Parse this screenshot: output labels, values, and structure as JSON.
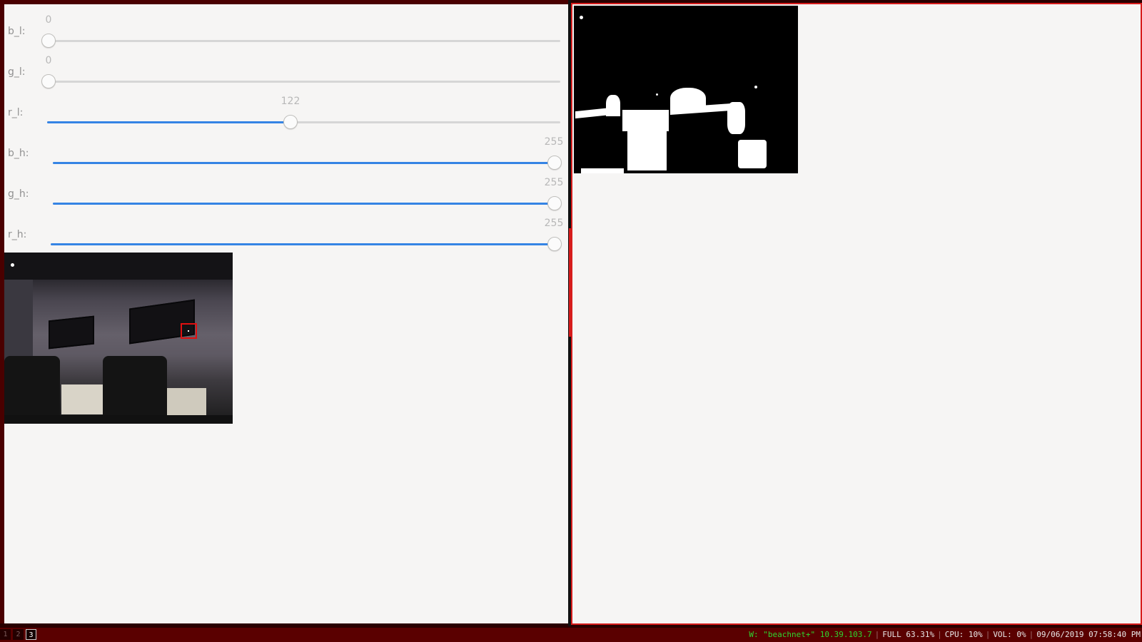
{
  "sliders": [
    {
      "key": "b_l",
      "label": "b_l:",
      "value": "0",
      "fraction": 0.0
    },
    {
      "key": "g_l",
      "label": "g_l:",
      "value": "0",
      "fraction": 0.0
    },
    {
      "key": "r_l",
      "label": "r_l:",
      "value": "122",
      "fraction": 0.478
    },
    {
      "key": "b_h",
      "label": "b_h:",
      "value": "255",
      "fraction": 1.0
    },
    {
      "key": "g_h",
      "label": "g_h:",
      "value": "255",
      "fraction": 1.0
    },
    {
      "key": "r_h",
      "label": "r_h:",
      "value": "255",
      "fraction": 1.0
    }
  ],
  "statusbar": {
    "workspaces": [
      "1",
      "2",
      "3"
    ],
    "active_workspace": "3",
    "wifi": "W: \"beachnet+\" 10.39.103.7",
    "battery": "FULL 63.31%",
    "cpu": "CPU: 10%",
    "volume": "VOL: 0%",
    "datetime": "09/06/2019 07:58:40 PM"
  },
  "colors": {
    "slider_fill": "#3584e4",
    "focus_border": "#d71c1c",
    "bar_background": "#5a0000",
    "wifi_text": "#2fd52f"
  }
}
